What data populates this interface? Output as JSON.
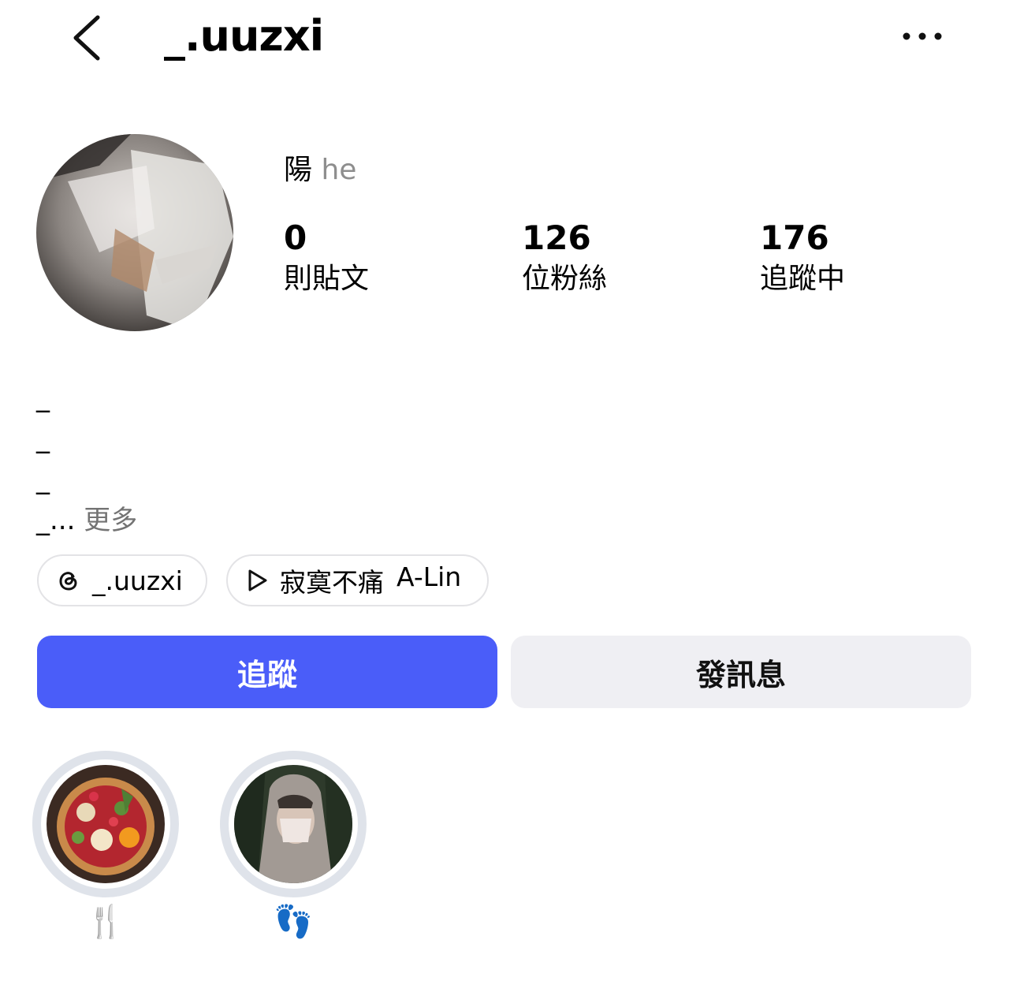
{
  "header": {
    "username": "_.uuzxi",
    "back_icon": "chevron-left-icon",
    "more_icon": "more-horizontal-icon"
  },
  "profile": {
    "name_cjk": "陽",
    "name_latin": "he",
    "stats": {
      "posts": {
        "value": "0",
        "label": "則貼文"
      },
      "followers": {
        "value": "126",
        "label": "位粉絲"
      },
      "following": {
        "value": "176",
        "label": "追蹤中"
      }
    },
    "bio": {
      "lines": [
        "_",
        "_",
        "_"
      ],
      "last_line": "_...",
      "more_label": "更多"
    }
  },
  "chips": {
    "threads": {
      "icon": "threads-icon",
      "label": "_.uuzxi"
    },
    "music": {
      "icon": "play-icon",
      "title": "寂寞不痛",
      "artist": "A-Lin"
    }
  },
  "actions": {
    "follow_label": "追蹤",
    "message_label": "發訊息"
  },
  "highlights": [
    {
      "label": "🍴"
    },
    {
      "label": "👣"
    }
  ],
  "colors": {
    "accent": "#4a5df9",
    "secondary_button": "#efeff3",
    "muted_text": "#8e8e8e"
  }
}
